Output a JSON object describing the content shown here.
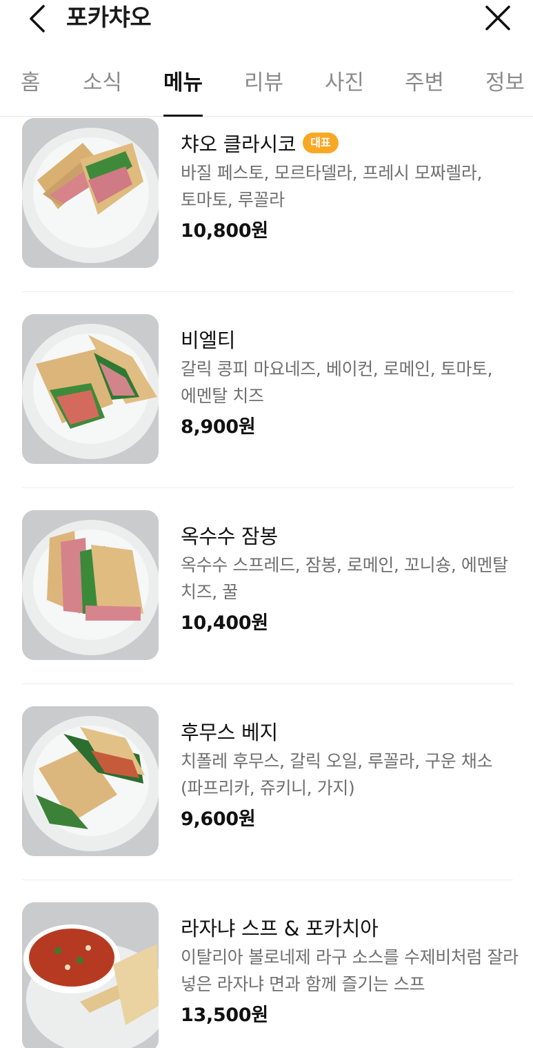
{
  "header": {
    "title": "포카챠오"
  },
  "tabs": [
    {
      "label": "홈"
    },
    {
      "label": "소식"
    },
    {
      "label": "메뉴",
      "active": true
    },
    {
      "label": "리뷰"
    },
    {
      "label": "사진"
    },
    {
      "label": "주변"
    },
    {
      "label": "정보"
    }
  ],
  "menu": {
    "items": [
      {
        "name": "챠오 클라시코",
        "badge": "대표",
        "desc": "바질 페스토, 모르타델라, 프레시 모짜렐라, 토마토, 루꼴라",
        "price": "10,800원"
      },
      {
        "name": "비엘티",
        "desc": "갈릭 콩피 마요네즈, 베이컨, 로메인, 토마토, 에멘탈 치즈",
        "price": "8,900원"
      },
      {
        "name": "옥수수 잠봉",
        "desc": "옥수수 스프레드, 잠봉, 로메인, 꼬니숑, 에멘탈 치즈, 꿀",
        "price": "10,400원"
      },
      {
        "name": "후무스 베지",
        "desc": "치폴레 후무스, 갈릭 오일, 루꼴라, 구운 채소(파프리카, 쥬키니, 가지)",
        "price": "9,600원"
      },
      {
        "name": "라자냐 스프 & 포카치아",
        "desc": "이탈리아 볼로네제 라구 소스를 수제비처럼 잘라 넣은 라자냐 면과 함께 즐기는 스프",
        "price": "13,500원"
      }
    ]
  },
  "colors": {
    "badge": "#f9a825",
    "active_tab": "#111111",
    "inactive_tab": "#8b8b8b",
    "description": "#6f6f6f"
  },
  "icons": {
    "back": "chevron-left-icon",
    "close": "close-icon"
  }
}
